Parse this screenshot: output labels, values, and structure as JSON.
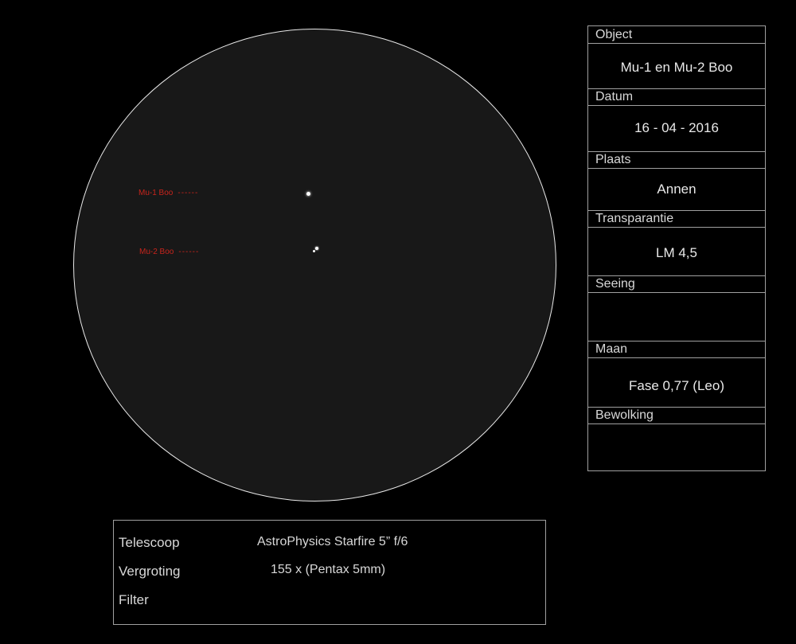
{
  "field": {
    "label_mu1": "Mu-1 Boo",
    "label_mu2": "Mu-2 Boo",
    "label_dash": "------"
  },
  "info": {
    "object_label": "Object",
    "object_value": "Mu-1 en Mu-2 Boo",
    "datum_label": "Datum",
    "datum_value": "16 - 04 - 2016",
    "plaats_label": "Plaats",
    "plaats_value": "Annen",
    "transparantie_label": "Transparantie",
    "transparantie_value": "LM 4,5",
    "seeing_label": "Seeing",
    "seeing_value": "",
    "maan_label": "Maan",
    "maan_value": "Fase 0,77 (Leo)",
    "bewolking_label": "Bewolking",
    "bewolking_value": ""
  },
  "equipment": {
    "telescoop_label": "Telescoop",
    "telescoop_value": "AstroPhysics Starfire 5” f/6",
    "vergroting_label": "Vergroting",
    "vergroting_value": "155 x (Pentax 5mm)",
    "filter_label": "Filter",
    "filter_value": ""
  },
  "colors": {
    "background": "#000000",
    "field": "#181818",
    "label_red": "#c8241c"
  }
}
